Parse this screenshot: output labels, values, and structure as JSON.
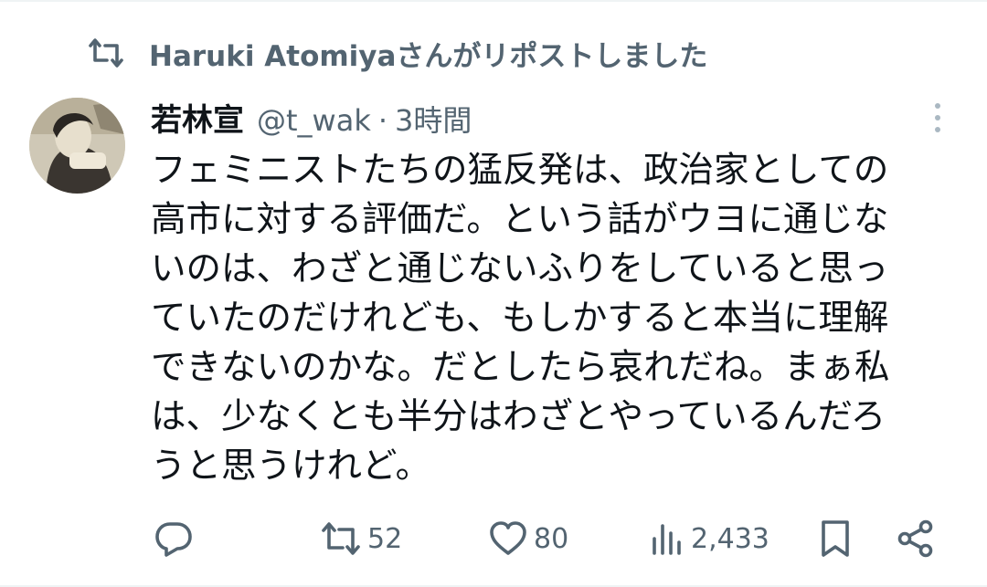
{
  "repost_header": {
    "text": "Haruki Atomiyaさんがリポストしました"
  },
  "tweet": {
    "author": {
      "display_name": "若林宣",
      "handle": "@t_wak",
      "separator": "·",
      "timestamp": "3時間"
    },
    "text_lines": [
      "フェミニストたちの猛反発は、政治家としての",
      "高市に対する評価だ。という話がウヨに通じな",
      "いのは、わざと通じないふりをしていると思っ",
      "ていたのだけれども、もしかすると本当に理解",
      "できないのかな。だとしたら哀れだね。まぁ私",
      "は、少なくとも半分はわざとやっているんだろ",
      "うと思うけれど。"
    ]
  },
  "actions": {
    "reply": {
      "icon": "reply-icon"
    },
    "retweet": {
      "icon": "retweet-icon",
      "count": "52"
    },
    "like": {
      "icon": "heart-icon",
      "count": "80"
    },
    "views": {
      "icon": "views-icon",
      "count": "2,433"
    },
    "bookmark": {
      "icon": "bookmark-icon"
    },
    "share": {
      "icon": "share-icon"
    }
  },
  "colors": {
    "text_primary": "#0f1419",
    "text_secondary": "#536471",
    "divider": "#eff3f4"
  }
}
